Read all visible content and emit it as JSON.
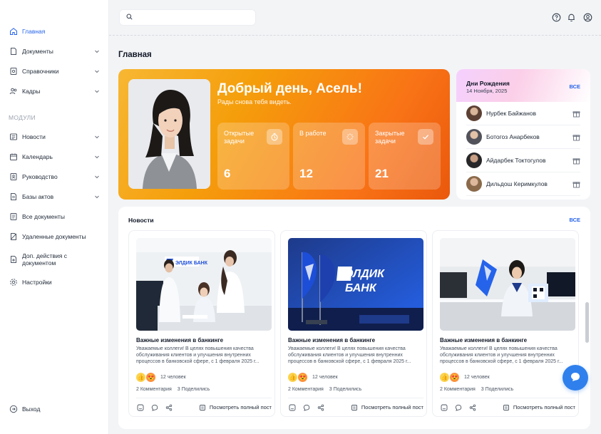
{
  "colors": {
    "accent": "#2563eb",
    "orange": "#f59e0b",
    "fab": "#2f80ed"
  },
  "sidebar": {
    "items": [
      {
        "label": "Главная",
        "icon": "home-icon",
        "active": true
      },
      {
        "label": "Документы",
        "icon": "document-icon",
        "chevron": true
      },
      {
        "label": "Справочники",
        "icon": "directory-icon",
        "chevron": true
      },
      {
        "label": "Кадры",
        "icon": "users-icon",
        "chevron": true
      }
    ],
    "section_label": "МОДУЛИ",
    "modules": [
      {
        "label": "Новости",
        "icon": "news-icon",
        "chevron": true
      },
      {
        "label": "Календарь",
        "icon": "calendar-icon",
        "chevron": true
      },
      {
        "label": "Руководство",
        "icon": "guide-icon",
        "chevron": true
      },
      {
        "label": "Базы актов",
        "icon": "database-icon",
        "chevron": true
      },
      {
        "label": "Все документы",
        "icon": "documents-icon"
      },
      {
        "label": "Удаленные документы",
        "icon": "deleted-icon"
      },
      {
        "label": "Доп. действия с документом",
        "icon": "doc-actions-icon"
      },
      {
        "label": "Настройки",
        "icon": "gear-icon"
      }
    ],
    "logout": "Выход"
  },
  "search": {
    "placeholder": "",
    "value": ""
  },
  "header_icons": [
    "help-icon",
    "bell-icon",
    "user-icon"
  ],
  "page_title": "Главная",
  "welcome": {
    "greeting": "Добрый день, Асель!",
    "subtitle": "Рады снова тебя видеть.",
    "stats": [
      {
        "label": "Открытые задачи",
        "value": "6",
        "icon": "timer-icon"
      },
      {
        "label": "В работе",
        "value": "12",
        "icon": "loader-icon"
      },
      {
        "label": "Закрытые задачи",
        "value": "21",
        "icon": "check-icon"
      }
    ]
  },
  "birthdays": {
    "title": "Дни Рождения",
    "date": "14 Ноября, 2025",
    "all_label": "ВСЕ",
    "people": [
      {
        "name": "Нурбек Байжанов",
        "avatar_color": "#8a6f5a"
      },
      {
        "name": "Ботогоз Анарбеков",
        "avatar_color": "#6b7280"
      },
      {
        "name": "Айдарбек Токтогулов",
        "avatar_color": "#3f3f46"
      },
      {
        "name": "Дильдош Керимкулов",
        "avatar_color": "#a16207"
      }
    ]
  },
  "news": {
    "title": "Новости",
    "all_label": "ВСЕ",
    "brand_text": [
      "ЭЛДИК",
      "БАНК"
    ],
    "sign_text": "ЭЛДИК БАНК",
    "items": [
      {
        "heading": "Важные изменения в банкинге",
        "text": "Уважаемые коллеги! В целях повышения качества обслуживания клиентов и улучшения внутренних процессов в банковской сфере, с 1 февраля 2025 г...",
        "reactions": "12 человек",
        "comments": "2 Комментария",
        "shares": "3 Поделились",
        "full_link": "Посмотреть полный пост"
      },
      {
        "heading": "Важные изменения в банкинге",
        "text": "Уважаемые коллеги! В целях повышения качества обслуживания клиентов и улучшения внутренних процессов в банковской сфере, с 1 февраля 2025 г...",
        "reactions": "12 человек",
        "comments": "2 Комментария",
        "shares": "3 Поделились",
        "full_link": "Посмотреть полный пост"
      },
      {
        "heading": "Важные изменения в банкинге",
        "text": "Уважаемые коллеги! В целях повышения качества обслуживания клиентов и улучшения внутренних процессов в банковской сфере, с 1 февраля 2025 г...",
        "reactions": "12 человек",
        "comments": "2 Комментария",
        "shares": "3 Поделились",
        "full_link": "Посмотреть полный пост"
      }
    ]
  }
}
